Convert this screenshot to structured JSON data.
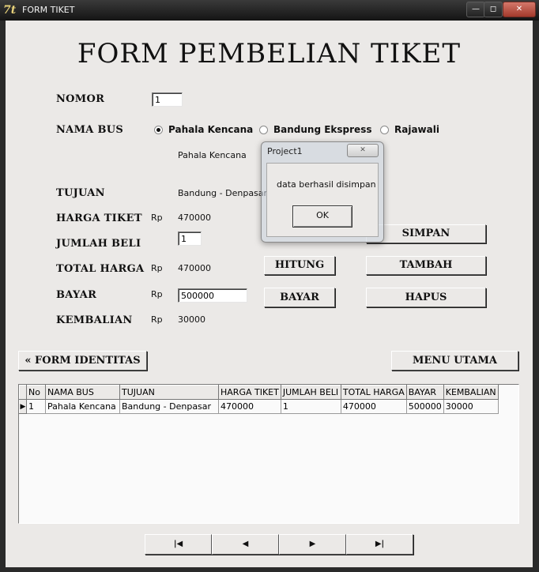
{
  "window": {
    "title": "FORM TIKET",
    "app_icon": "7t"
  },
  "controls": {
    "minimize": "—",
    "maximize": "◻",
    "close": "✕"
  },
  "heading": "FORM PEMBELIAN TIKET",
  "labels": {
    "nomor": "NOMOR",
    "nama_bus": "NAMA BUS",
    "tujuan": "TUJUAN",
    "harga_tiket": "HARGA TIKET",
    "jumlah_beli": "JUMLAH BELI",
    "total_harga": "TOTAL HARGA",
    "bayar": "BAYAR",
    "kembalian": "KEMBALIAN"
  },
  "currency": "Rp",
  "fields": {
    "nomor": "1",
    "selected_bus": "Pahala Kencana",
    "tujuan": "Bandung - Denpasar",
    "harga_tiket": "470000",
    "jumlah_beli": "1",
    "total_harga": "470000",
    "bayar": "500000",
    "kembalian": "30000"
  },
  "bus_options": [
    {
      "label": "Pahala Kencana",
      "selected": true
    },
    {
      "label": "Bandung Ekspress",
      "selected": false
    },
    {
      "label": "Rajawali",
      "selected": false
    }
  ],
  "buttons": {
    "simpan": "SIMPAN",
    "hitung": "HITUNG",
    "tambah": "TAMBAH",
    "bayar": "BAYAR",
    "hapus": "HAPUS",
    "form_identitas": "« FORM IDENTITAS",
    "menu_utama": "MENU UTAMA"
  },
  "grid": {
    "columns": [
      "No",
      "NAMA BUS",
      "TUJUAN",
      "HARGA TIKET",
      "JUMLAH BELI",
      "TOTAL HARGA",
      "BAYAR",
      "KEMBALIAN"
    ],
    "rows": [
      [
        "1",
        "Pahala Kencana",
        "Bandung - Denpasar",
        "470000",
        "1",
        "470000",
        "500000",
        "30000"
      ]
    ],
    "row_indicator": "▶"
  },
  "navigator": {
    "first": "|◀",
    "prior": "◀",
    "next": "▶",
    "last": "▶|"
  },
  "dialog": {
    "title": "Project1",
    "message": "data berhasil disimpan",
    "ok": "OK",
    "close": "✕"
  }
}
